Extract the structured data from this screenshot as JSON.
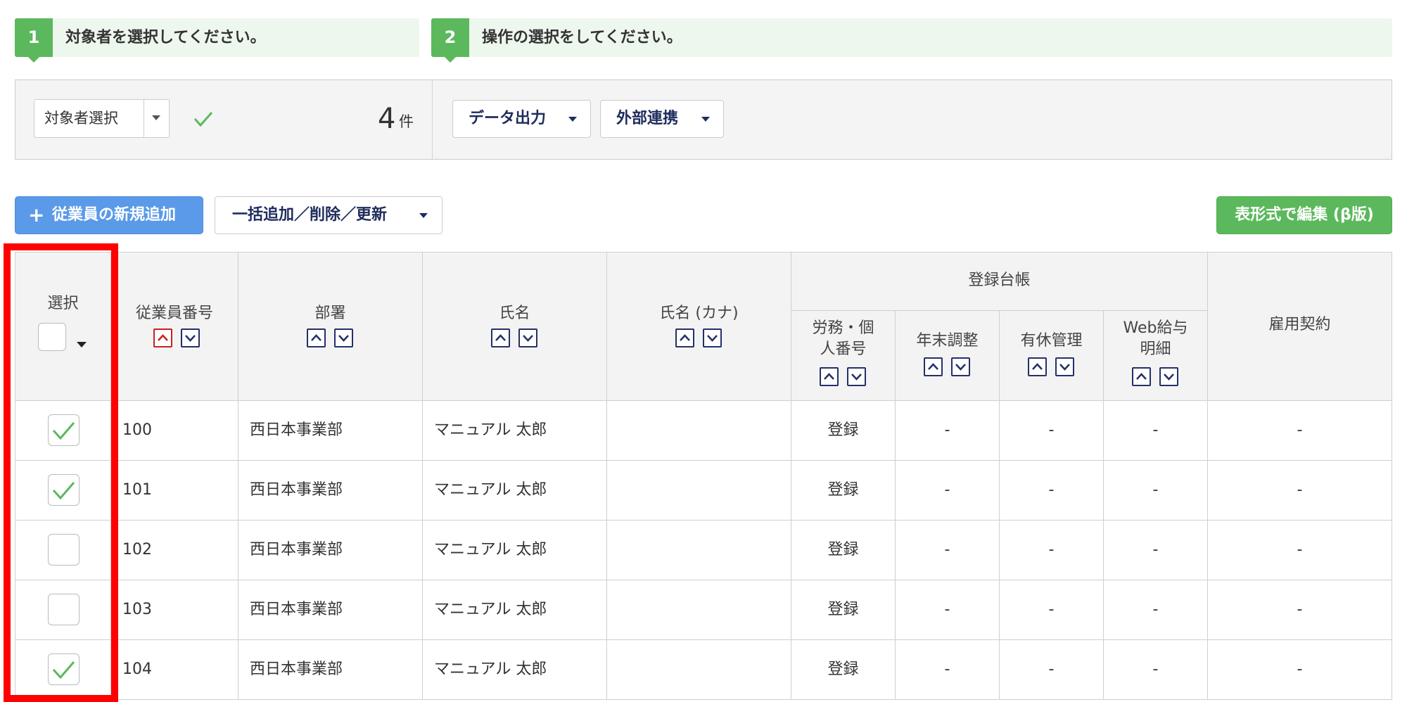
{
  "steps": [
    {
      "number": "1",
      "text": "対象者を選択してください。"
    },
    {
      "number": "2",
      "text": "操作の選択をしてください。"
    }
  ],
  "target": {
    "select_value": "対象者選択",
    "count_value": "4",
    "count_unit": "件"
  },
  "actions": {
    "data_export": "データ出力",
    "external_link": "外部連携"
  },
  "toolbar": {
    "add_plus": "+",
    "add_employee": "従業員の新規追加",
    "bulk_ops": "一括追加／削除／更新",
    "table_edit": "表形式で編集 (β版)"
  },
  "table": {
    "headers": {
      "select": "選択",
      "employee_no": "従業員番号",
      "department": "部署",
      "name": "氏名",
      "name_kana": "氏名 (カナ)",
      "ledger_group": "登録台帳",
      "labor_line1": "労務・個",
      "labor_line2": "人番号",
      "year_end": "年末調整",
      "paid_leave": "有休管理",
      "web_pay_line1": "Web給与",
      "web_pay_line2": "明細",
      "employment": "雇用契約"
    },
    "rows": [
      {
        "checked": true,
        "employee_no": "100",
        "department": "西日本事業部",
        "name": "マニュアル 太郎",
        "name_kana": "",
        "labor": "登録",
        "year_end": "-",
        "paid_leave": "-",
        "web_pay": "-",
        "employment": "-"
      },
      {
        "checked": true,
        "employee_no": "101",
        "department": "西日本事業部",
        "name": "マニュアル 太郎",
        "name_kana": "",
        "labor": "登録",
        "year_end": "-",
        "paid_leave": "-",
        "web_pay": "-",
        "employment": "-"
      },
      {
        "checked": false,
        "employee_no": "102",
        "department": "西日本事業部",
        "name": "マニュアル 太郎",
        "name_kana": "",
        "labor": "登録",
        "year_end": "-",
        "paid_leave": "-",
        "web_pay": "-",
        "employment": "-"
      },
      {
        "checked": false,
        "employee_no": "103",
        "department": "西日本事業部",
        "name": "マニュアル 太郎",
        "name_kana": "",
        "labor": "登録",
        "year_end": "-",
        "paid_leave": "-",
        "web_pay": "-",
        "employment": "-"
      },
      {
        "checked": true,
        "employee_no": "104",
        "department": "西日本事業部",
        "name": "マニュアル 太郎",
        "name_kana": "",
        "labor": "登録",
        "year_end": "-",
        "paid_leave": "-",
        "web_pay": "-",
        "employment": "-"
      }
    ]
  },
  "colors": {
    "accent_green": "#5cb85c",
    "accent_blue": "#5a9ae8",
    "highlight_red": "#ff0000",
    "check_green": "#5cb85c"
  }
}
